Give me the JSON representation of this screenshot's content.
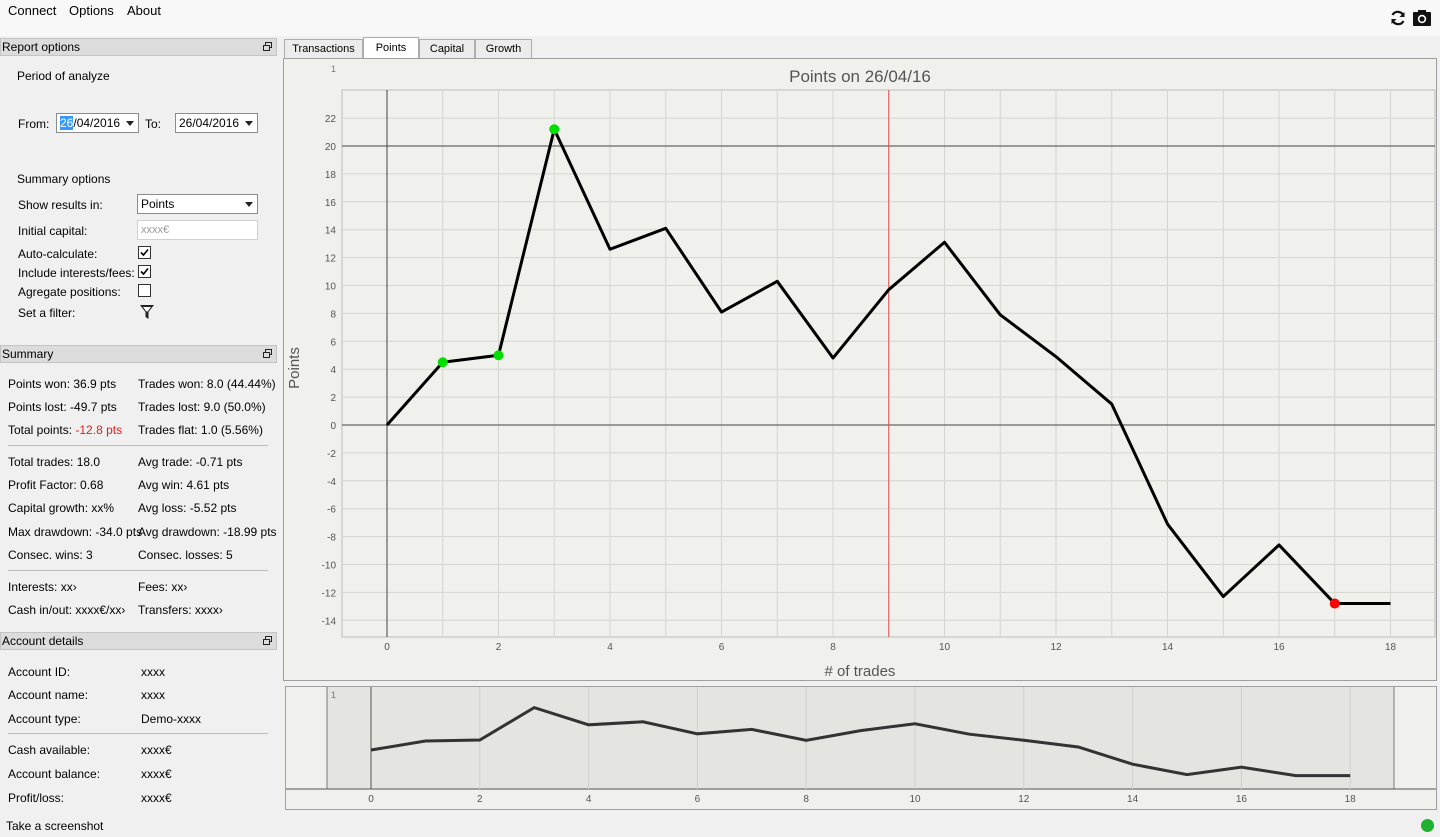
{
  "menu": [
    "Connect",
    "Options",
    "About"
  ],
  "toolbar": {
    "icons": [
      "refresh-icon",
      "camera-icon"
    ]
  },
  "report_options": {
    "title": "Report options",
    "period_label": "Period of analyze",
    "from_label": "From:",
    "from_value_selected": "26",
    "from_value_rest": "/04/2016",
    "to_label": "To:",
    "to_value": "26/04/2016",
    "summary_options_label": "Summary options",
    "show_results_label": "Show results in:",
    "show_results_value": "Points",
    "initial_capital_label": "Initial capital:",
    "initial_capital_placeholder": "xxxx€",
    "auto_calc_label": "Auto-calculate:",
    "auto_calc_checked": true,
    "include_fees_label": "Include interests/fees:",
    "include_fees_checked": true,
    "aggregate_label": "Agregate positions:",
    "aggregate_checked": false,
    "filter_label": "Set a filter:"
  },
  "summary": {
    "title": "Summary",
    "points_won": "Points won: 36.9 pts",
    "trades_won": "Trades won: 8.0 (44.44%)",
    "points_lost": "Points lost: -49.7 pts",
    "trades_lost": "Trades lost: 9.0 (50.0%)",
    "total_points_label": "Total points:",
    "total_points_value": "-12.8 pts",
    "trades_flat": "Trades flat: 1.0 (5.56%)",
    "total_trades": "Total trades: 18.0",
    "avg_trade": "Avg trade: -0.71 pts",
    "profit_factor": "Profit Factor: 0.68",
    "avg_win": "Avg win: 4.61 pts",
    "capital_growth": "Capital growth: xx%",
    "avg_loss": "Avg loss: -5.52 pts",
    "max_drawdown": "Max drawdown: -34.0 pts",
    "avg_drawdown": "Avg drawdown: -18.99 pts",
    "consec_wins": "Consec. wins: 3",
    "consec_losses": "Consec. losses: 5",
    "interests": "Interests: xx›",
    "fees": "Fees: xx›",
    "cash_inout": "Cash in/out: xxxx€/xx›",
    "transfers": "Transfers: xxxx›"
  },
  "account": {
    "title": "Account details",
    "rows1": [
      {
        "label": "Account ID:",
        "value": "xxxx"
      },
      {
        "label": "Account name:",
        "value": "xxxx"
      },
      {
        "label": "Account type:",
        "value": "Demo-xxxx"
      }
    ],
    "rows2": [
      {
        "label": "Cash available:",
        "value": "xxxx€"
      },
      {
        "label": "Account balance:",
        "value": "xxxx€"
      },
      {
        "label": "Profit/loss:",
        "value": "xxxx€"
      }
    ]
  },
  "tabs": [
    "Transactions",
    "Points",
    "Capital",
    "Growth"
  ],
  "active_tab": "Points",
  "status_text": "Take a screenshot",
  "chart_data": [
    {
      "type": "line",
      "title": "Points on 26/04/16",
      "xlabel": "# of trades",
      "ylabel": "Points",
      "corner_label": "1",
      "x": [
        0,
        1,
        2,
        3,
        4,
        5,
        6,
        7,
        8,
        9,
        10,
        11,
        12,
        13,
        14,
        15,
        16,
        17,
        18
      ],
      "y": [
        0,
        4.5,
        5.0,
        21.2,
        12.6,
        14.1,
        8.1,
        10.3,
        4.8,
        9.7,
        13.1,
        7.9,
        4.9,
        1.5,
        -7.1,
        -12.3,
        -8.6,
        -12.8,
        -12.8
      ],
      "markers": [
        {
          "x": 1,
          "color": "#00e000"
        },
        {
          "x": 2,
          "color": "#00e000"
        },
        {
          "x": 3,
          "color": "#00e000"
        },
        {
          "x": 17,
          "color": "#ff0000"
        }
      ],
      "vline_x": 9,
      "hline_y": 20,
      "xlim": [
        -0.8,
        18.8
      ],
      "ylim": [
        -15,
        23.5
      ],
      "xticks": [
        0,
        2,
        4,
        6,
        8,
        10,
        12,
        14,
        16,
        18
      ],
      "yticks": [
        -14,
        -12,
        -10,
        -8,
        -6,
        -4,
        -2,
        0,
        2,
        4,
        6,
        8,
        10,
        12,
        14,
        16,
        18,
        20,
        22
      ],
      "grid": true,
      "line_color": "#000000",
      "vline_color": "#e05050"
    },
    {
      "type": "line",
      "corner_label": "1",
      "x": [
        0,
        1,
        2,
        3,
        4,
        5,
        6,
        7,
        8,
        9,
        10,
        11,
        12,
        13,
        14,
        15,
        16,
        17,
        18
      ],
      "y": [
        0,
        4.5,
        5.0,
        21.2,
        12.6,
        14.1,
        8.1,
        10.3,
        4.8,
        9.7,
        13.1,
        7.9,
        4.9,
        1.5,
        -7.1,
        -12.3,
        -8.6,
        -12.8,
        -12.8
      ],
      "xlim": [
        -0.8,
        18.8
      ],
      "ylim": [
        -15,
        23.5
      ],
      "xticks": [
        0,
        2,
        4,
        6,
        8,
        10,
        12,
        14,
        16,
        18
      ],
      "line_color": "#333333"
    }
  ]
}
